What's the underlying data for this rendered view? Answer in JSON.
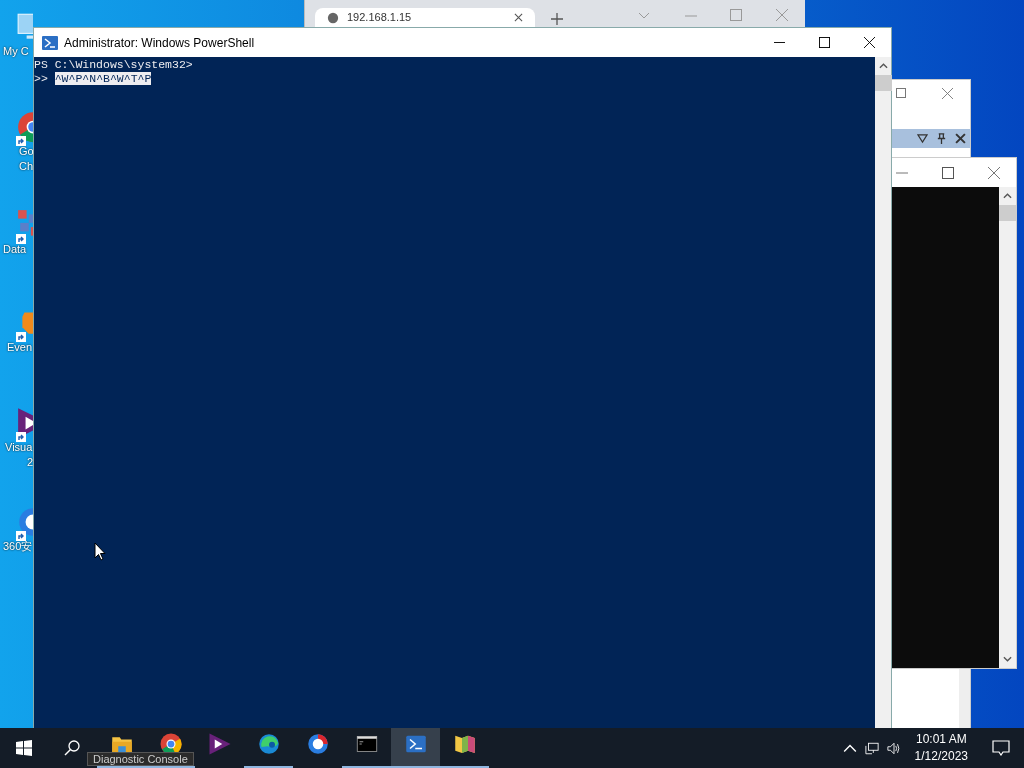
{
  "desktop_icons": [
    {
      "kind": "computer",
      "lines": [
        "My C"
      ]
    },
    {
      "kind": "chrome",
      "lines": [
        "Go",
        "Ch"
      ]
    },
    {
      "kind": "grid",
      "lines": [
        "Data"
      ]
    },
    {
      "kind": "elephant",
      "lines": [
        "Even"
      ]
    },
    {
      "kind": "studio",
      "lines": [
        "Visua",
        "2"
      ]
    },
    {
      "kind": "shield",
      "lines": [
        "360安"
      ]
    }
  ],
  "browser_window": {
    "tab_title": "192.168.1.15"
  },
  "powershell": {
    "title": "Administrator: Windows PowerShell",
    "lines": [
      {
        "prompt": "PS C:\\Windows\\system32>"
      },
      {
        "prompt": ">> ",
        "input": "^W^P^N^B^W^T^P",
        "selected": true
      }
    ]
  },
  "taskbar": {
    "tooltip": "Diagnostic Console",
    "apps": [
      {
        "kind": "folder",
        "running": true,
        "active": false
      },
      {
        "kind": "chrome",
        "running": true,
        "active": false
      },
      {
        "kind": "studio",
        "running": false,
        "active": false
      },
      {
        "kind": "edge",
        "running": true,
        "active": false
      },
      {
        "kind": "shield",
        "running": false,
        "active": false
      },
      {
        "kind": "console",
        "running": true,
        "active": false
      },
      {
        "kind": "powershell",
        "running": true,
        "active": true
      },
      {
        "kind": "map",
        "running": true,
        "active": false
      }
    ],
    "clock": {
      "time": "10:01 AM",
      "date": "1/12/2023"
    }
  }
}
